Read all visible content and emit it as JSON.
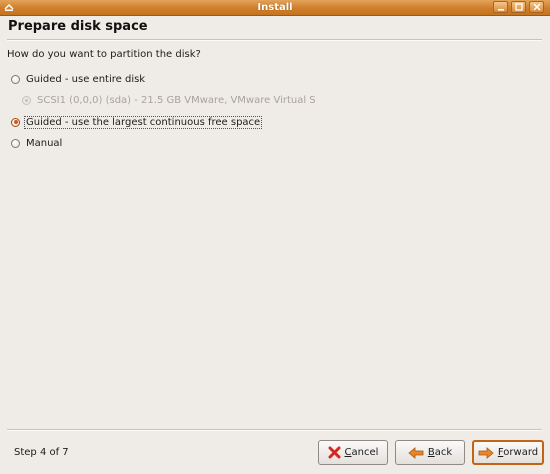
{
  "window": {
    "title": "Install",
    "controls": [
      "minimize-icon",
      "maximize-icon",
      "close-icon"
    ]
  },
  "page": {
    "title": "Prepare disk space",
    "question": "How do you want to partition the disk?"
  },
  "options": [
    {
      "label": "Guided - use entire disk",
      "selected": false,
      "disabled": false
    },
    {
      "label": "SCSI1 (0,0,0) (sda) - 21.5 GB VMware, VMware Virtual S",
      "selected": true,
      "disabled": true
    },
    {
      "label": "Guided - use the largest continuous free space",
      "selected": true,
      "disabled": false
    },
    {
      "label": "Manual",
      "selected": false,
      "disabled": false
    }
  ],
  "footer": {
    "step": "Step 4 of 7",
    "cancel_mnemonic": "C",
    "cancel_rest": "ancel",
    "back_mnemonic": "B",
    "back_rest": "ack",
    "forward_mnemonic": "F",
    "forward_rest": "orward"
  },
  "colors": {
    "titlebar": "#cf7f2a",
    "background": "#efebe7",
    "accent": "#d4571a",
    "cancel_icon": "#d6261f",
    "arrow_icon": "#e8862a"
  }
}
